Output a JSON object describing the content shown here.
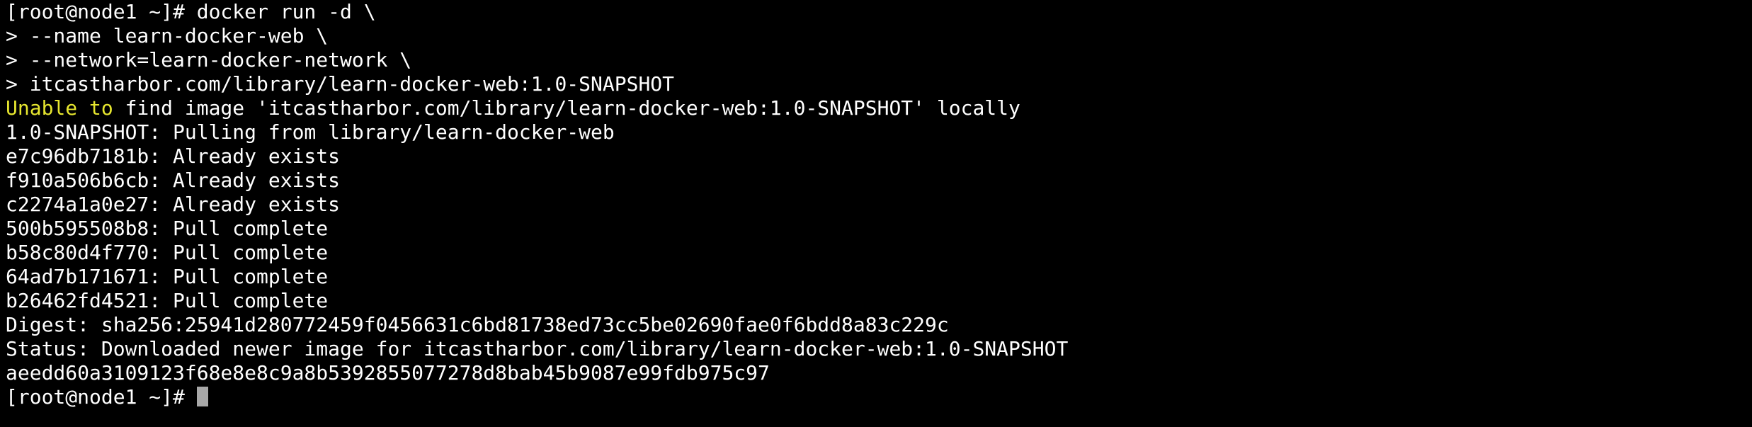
{
  "colors": {
    "background": "#000000",
    "text": "#ffffff",
    "warning": "#e6e62f",
    "cursor": "#a8a8a8"
  },
  "terminal": {
    "lines": [
      "[root@node1 ~]# docker run -d \\",
      "> --name learn-docker-web \\",
      "> --network=learn-docker-network \\",
      "> itcastharbor.com/library/learn-docker-web:1.0-SNAPSHOT"
    ],
    "warning_line": {
      "highlight": "Unable to",
      "rest": " find image 'itcastharbor.com/library/learn-docker-web:1.0-SNAPSHOT' locally"
    },
    "output": [
      "1.0-SNAPSHOT: Pulling from library/learn-docker-web",
      "e7c96db7181b: Already exists",
      "f910a506b6cb: Already exists",
      "c2274a1a0e27: Already exists",
      "500b595508b8: Pull complete",
      "b58c80d4f770: Pull complete",
      "64ad7b171671: Pull complete",
      "b26462fd4521: Pull complete",
      "Digest: sha256:25941d280772459f0456631c6bd81738ed73cc5be02690fae0f6bdd8a83c229c",
      "Status: Downloaded newer image for itcastharbor.com/library/learn-docker-web:1.0-SNAPSHOT",
      "aeedd60a3109123f68e8e8c9a8b5392855077278d8bab45b9087e99fdb975c97"
    ],
    "prompt": "[root@node1 ~]# "
  }
}
